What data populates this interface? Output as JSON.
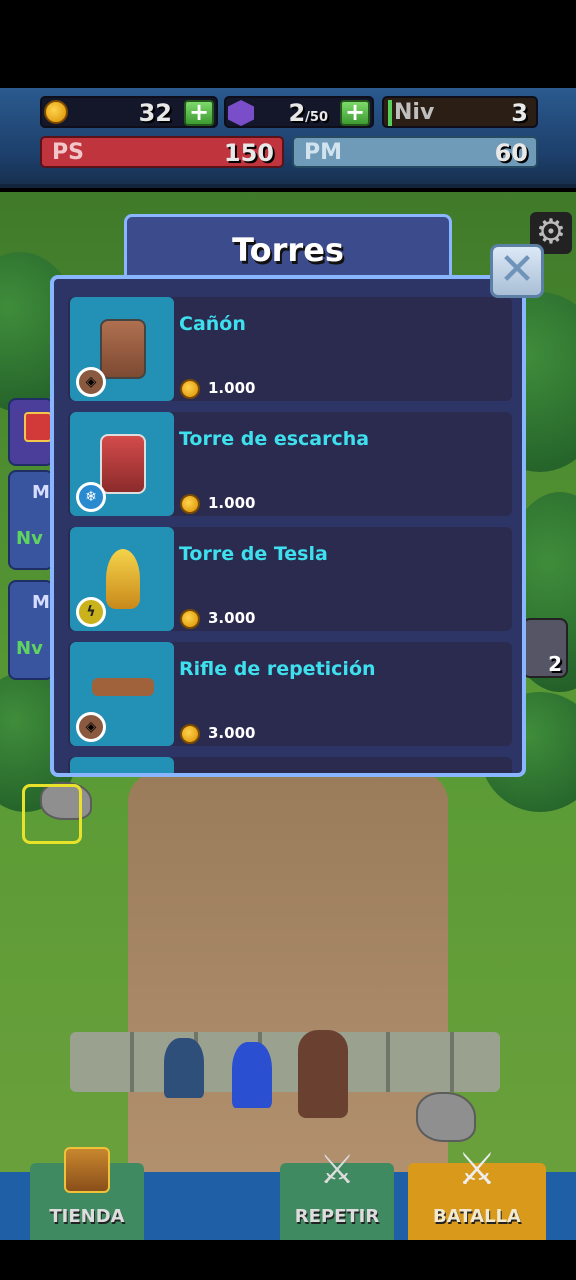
{
  "hud": {
    "coins": "32",
    "gems": "2",
    "gems_max": "/50",
    "level_label": "Niv",
    "level_value": "3",
    "ps_label": "PS",
    "ps_value": "150",
    "pm_label": "PM",
    "pm_value": "60"
  },
  "modal": {
    "title": "Torres",
    "close_icon": "close-icon",
    "items": [
      {
        "name": "Cañón",
        "price": "1.000",
        "badge_icon": "target-badge-icon"
      },
      {
        "name": "Torre de escarcha",
        "price": "1.000",
        "badge_icon": "snowflake-badge-icon"
      },
      {
        "name": "Torre de Tesla",
        "price": "3.000",
        "badge_icon": "lightning-badge-icon"
      },
      {
        "name": "Rifle de repetición",
        "price": "3.000",
        "badge_icon": "target-badge-icon"
      }
    ]
  },
  "side_cards": [
    {
      "letter": "M",
      "level": "Nv"
    },
    {
      "letter": "M",
      "level": "Nv"
    }
  ],
  "right_item_count": "2",
  "nav": {
    "shop": "TIENDA",
    "repeat": "REPETIR",
    "battle": "BATALLA"
  },
  "colors": {
    "accent_cyan": "#3fe0ee",
    "modal_border": "#8ab5ff",
    "battle_button": "#d99a1c",
    "selection_highlight": "#e8e22a"
  }
}
